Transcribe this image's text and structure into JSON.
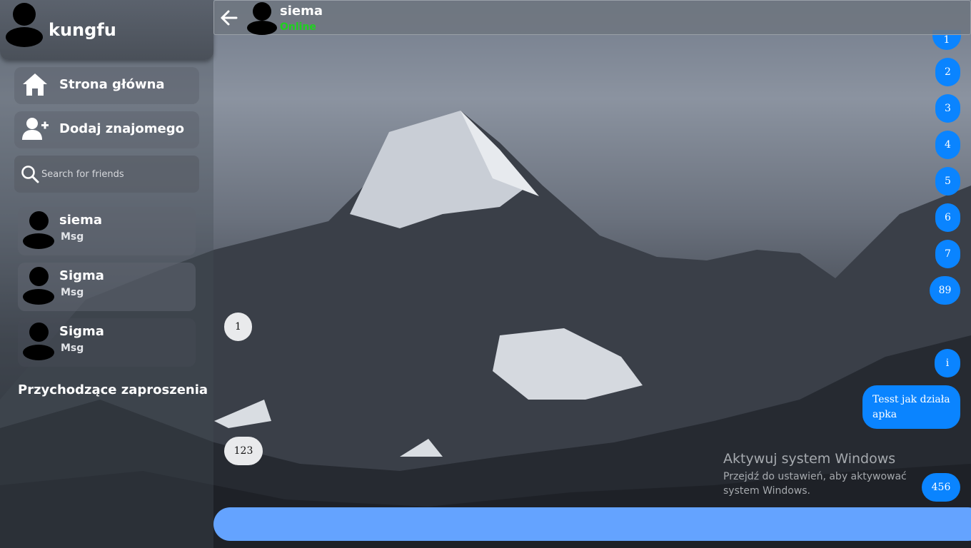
{
  "user": {
    "name": "kungfu"
  },
  "nav": {
    "home_label": "Strona główna",
    "add_friend_label": "Dodaj znajomego"
  },
  "search": {
    "placeholder": "Search for friends"
  },
  "friends": [
    {
      "name": "siema",
      "preview": "Msg"
    },
    {
      "name": "Sigma",
      "preview": "Msg"
    },
    {
      "name": "Sigma",
      "preview": "Msg"
    }
  ],
  "invites": {
    "title": "Przychodzące zaproszenia"
  },
  "chat": {
    "contact_name": "siema",
    "status": "Online",
    "messages": [
      {
        "text": "1",
        "direction": "sent"
      },
      {
        "text": "2",
        "direction": "sent"
      },
      {
        "text": "3",
        "direction": "sent"
      },
      {
        "text": "4",
        "direction": "sent"
      },
      {
        "text": "5",
        "direction": "sent"
      },
      {
        "text": "6",
        "direction": "sent"
      },
      {
        "text": "7",
        "direction": "sent"
      },
      {
        "text": "89",
        "direction": "sent"
      },
      {
        "text": "1",
        "direction": "received"
      },
      {
        "text": "i",
        "direction": "sent"
      },
      {
        "text": "Tesst jak działa apka",
        "direction": "sent"
      },
      {
        "text": "123",
        "direction": "received"
      },
      {
        "text": "456",
        "direction": "sent"
      }
    ]
  },
  "watermark": {
    "title": "Aktywuj system Windows",
    "subtitle": "Przejdź do ustawień, aby aktywować system Windows."
  },
  "colors": {
    "sent_bubble": "#0a84ff",
    "received_bubble": "#e9eaec",
    "composer": "#64a3ff",
    "online": "#1fd11f"
  },
  "icons": {
    "home": "home-icon",
    "add_user": "add-user-icon",
    "search": "search-icon",
    "back": "arrow-left-icon"
  }
}
